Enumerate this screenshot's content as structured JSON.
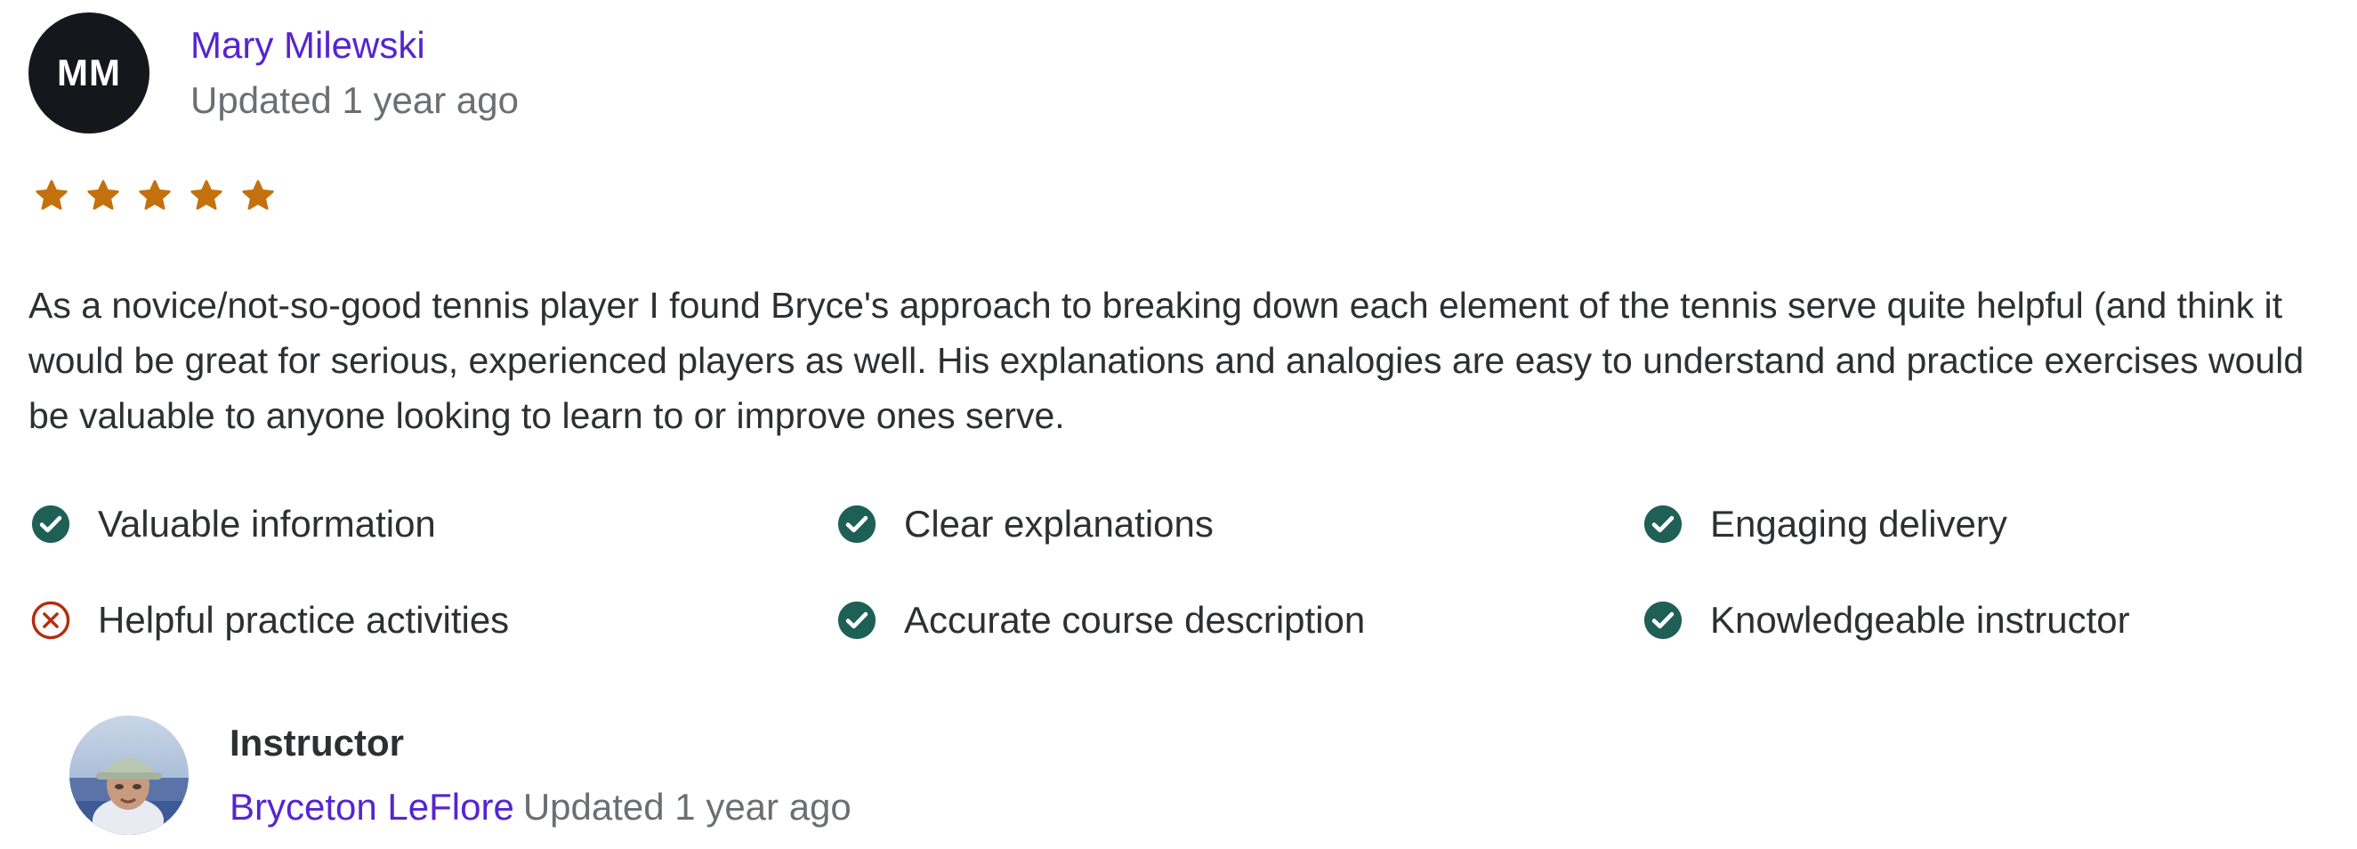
{
  "review": {
    "reviewer": {
      "initials": "MM",
      "name": "Mary Milewski",
      "updated": "Updated 1 year ago"
    },
    "rating": 5,
    "rating_max": 5,
    "star_color": "#c4710d",
    "body": "As a novice/not-so-good tennis player I found Bryce's approach to breaking down each element of the tennis serve quite helpful (and think it would be great for serious, experienced players as well. His explanations and analogies are easy to understand and practice exercises would be valuable to anyone looking to learn to or improve ones serve.",
    "attributes": [
      {
        "label": "Valuable information",
        "status": "positive",
        "icon": "check-circle-icon"
      },
      {
        "label": "Clear explanations",
        "status": "positive",
        "icon": "check-circle-icon"
      },
      {
        "label": "Engaging delivery",
        "status": "positive",
        "icon": "check-circle-icon"
      },
      {
        "label": "Helpful practice activities",
        "status": "negative",
        "icon": "x-circle-icon"
      },
      {
        "label": "Accurate course description",
        "status": "positive",
        "icon": "check-circle-icon"
      },
      {
        "label": "Knowledgeable instructor",
        "status": "positive",
        "icon": "check-circle-icon"
      }
    ],
    "colors": {
      "positive": "#1e6055",
      "negative": "#b32d0f",
      "link": "#5624d0",
      "muted": "#6a6f73"
    }
  },
  "instructor_response": {
    "role": "Instructor",
    "name": "Bryceton LeFlore",
    "updated": "Updated 1 year ago"
  }
}
